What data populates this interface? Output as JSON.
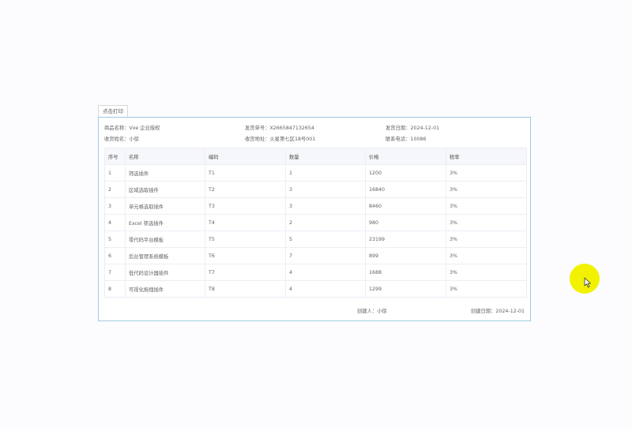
{
  "print_button": "点击打印",
  "info": {
    "product_label": "商品名称：",
    "product_value": "Vxe 企业授权",
    "order_label": "发货单号：",
    "order_value": "X2665847132654",
    "ship_date_label": "发货日期：",
    "ship_date_value": "2024-12-01",
    "receiver_label": "收货姓名：",
    "receiver_value": "小徐",
    "address_label": "收货地址：",
    "address_value": "火星第七区18号001",
    "phone_label": "联系电话：",
    "phone_value": "10086"
  },
  "table": {
    "headers": [
      "序号",
      "名称",
      "编码",
      "数量",
      "价格",
      "税率"
    ],
    "rows": [
      [
        "1",
        "筛选插件",
        "T1",
        "1",
        "1200",
        "3%"
      ],
      [
        "2",
        "区域选取插件",
        "T2",
        "3",
        "16840",
        "3%"
      ],
      [
        "3",
        "单元格选取插件",
        "T3",
        "3",
        "8460",
        "3%"
      ],
      [
        "4",
        "Excel 筛选插件",
        "T4",
        "2",
        "980",
        "3%"
      ],
      [
        "5",
        "零代码平台模板",
        "T5",
        "5",
        "23199",
        "3%"
      ],
      [
        "6",
        "后台管理系统模板",
        "T6",
        "7",
        "899",
        "3%"
      ],
      [
        "7",
        "低代码设计器插件",
        "T7",
        "4",
        "1688",
        "3%"
      ],
      [
        "8",
        "可视化拖拽插件",
        "T8",
        "4",
        "1299",
        "3%"
      ]
    ]
  },
  "footer": {
    "creator": "创建人：小徐",
    "created_date": "创建日期：2024-12-01"
  },
  "cursor": {
    "icon": "mouse-pointer-icon",
    "highlight_color": "#f2f200"
  }
}
